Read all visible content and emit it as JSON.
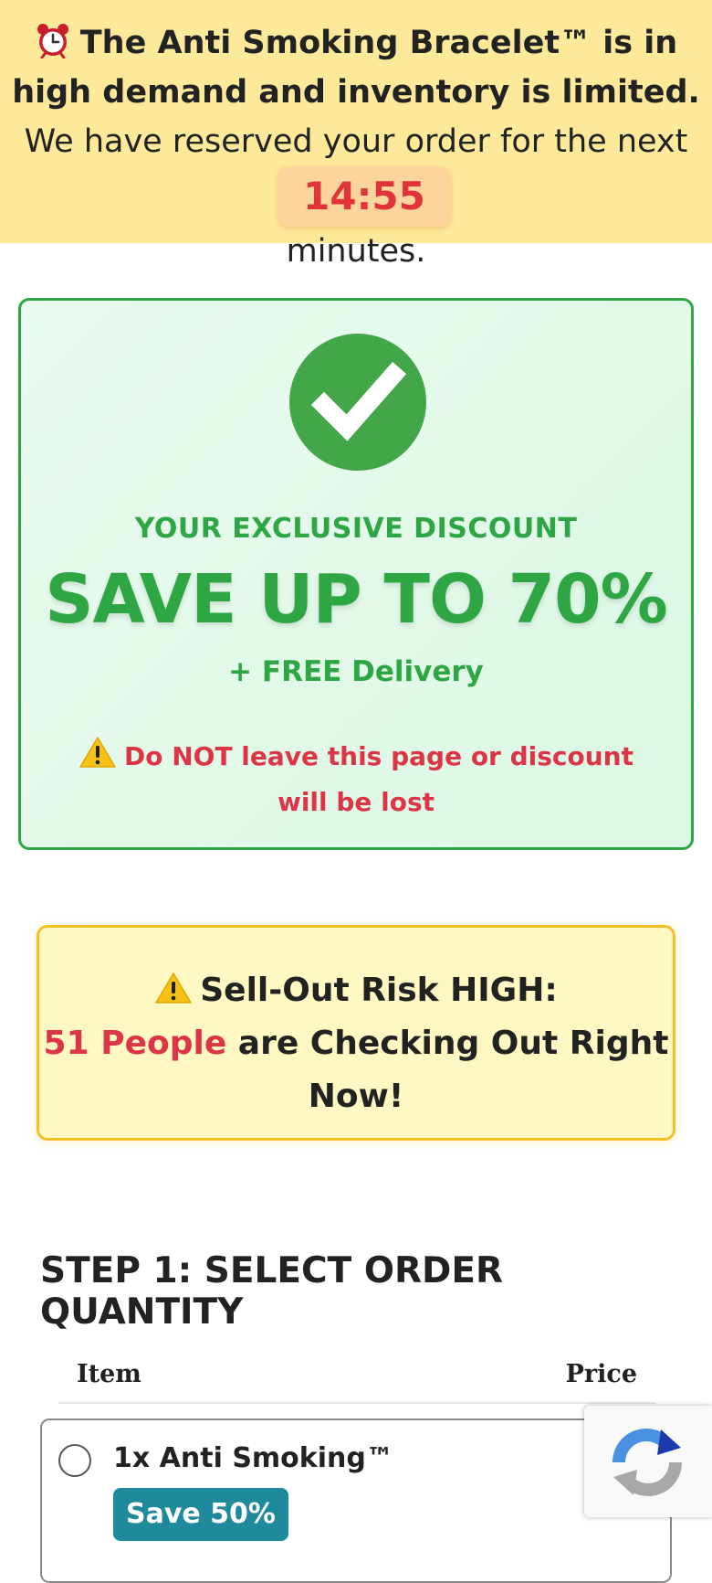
{
  "banner": {
    "bold_text": "The Anti Smoking Bracelet™ is in high demand and inventory is limited.",
    "text": "We have reserved your order for the next",
    "timer": "14:55",
    "suffix": "minutes."
  },
  "discount": {
    "subtitle": "YOUR EXCLUSIVE DISCOUNT",
    "headline": "SAVE UP TO 70%",
    "free_delivery": "+ FREE Delivery",
    "warning": "Do NOT leave this page or discount will be lost"
  },
  "sellout": {
    "title": "Sell-Out Risk HIGH:",
    "count": "51",
    "people": "People",
    "rest": "are Checking Out Right Now!"
  },
  "step": {
    "title": "STEP 1: SELECT ORDER QUANTITY"
  },
  "table": {
    "col_item": "Item",
    "col_price": "Price"
  },
  "products": [
    {
      "name": "1x Anti Smoking™",
      "badge": "Save 50%"
    }
  ],
  "colors": {
    "banner_bg": "#fde99a",
    "timer": "#e0333a",
    "green": "#2ea644",
    "red": "#dc3545",
    "risk_border": "#f6c026",
    "badge": "#1f8a9c"
  },
  "icons": {
    "banner": "alarm-clock-icon",
    "discount": "check-circle-icon",
    "warning": "warning-icon",
    "captcha": "recaptcha-icon"
  }
}
